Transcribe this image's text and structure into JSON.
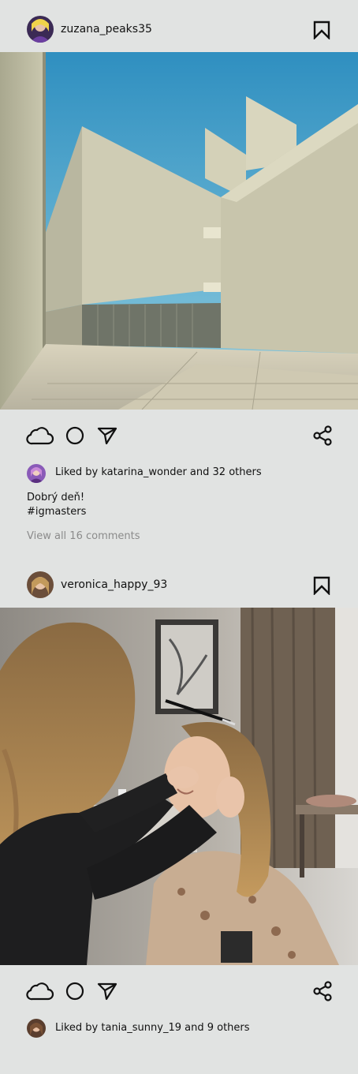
{
  "posts": [
    {
      "username": "zuzana_peaks35",
      "liked_by_user": "katarina_wonder",
      "liked_text": "Liked by katarina_wonder and 32 others",
      "caption_line1": "Dobrý deň!",
      "caption_line2": "#igmasters",
      "comments_link": "View all 16 comments",
      "photo_desc_icon": "concrete-architecture-photo"
    },
    {
      "username": "veronica_happy_93",
      "liked_by_user": "tania_sunny_19",
      "liked_text": "Liked by tania_sunny_19 and 9 others",
      "photo_desc_icon": "makeup-artist-photo"
    }
  ],
  "colors": {
    "background": "#e1e3e2",
    "text": "#111111",
    "muted": "#8b8b8b",
    "sky": "#4aa6c8",
    "concrete": "#c9c6b2"
  }
}
